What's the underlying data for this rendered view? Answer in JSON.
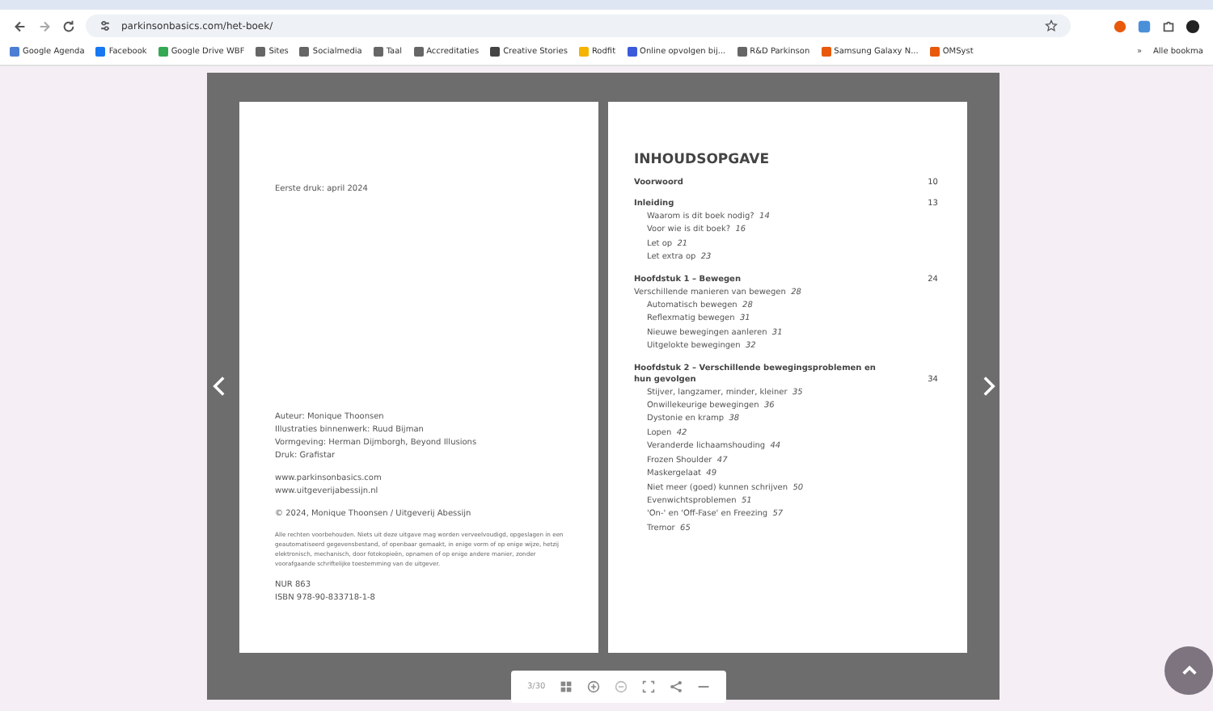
{
  "browser": {
    "url": "parkinsonbasics.com/het-boek/",
    "bookmarks": [
      {
        "label": "Google Agenda"
      },
      {
        "label": "Facebook"
      },
      {
        "label": "Google Drive WBF"
      },
      {
        "label": "Sites"
      },
      {
        "label": "Socialmedia"
      },
      {
        "label": "Taal"
      },
      {
        "label": "Accreditaties"
      },
      {
        "label": "Creative Stories"
      },
      {
        "label": "Rodfit"
      },
      {
        "label": "Online opvolgen bij..."
      },
      {
        "label": "R&D Parkinson"
      },
      {
        "label": "Samsung Galaxy N..."
      },
      {
        "label": "OMSyst"
      }
    ],
    "overflow": "»",
    "all_bookmarks": "Alle bookma"
  },
  "book": {
    "left_page": {
      "edition": "Eerste druk: april 2024",
      "credits": [
        "Auteur: Monique Thoonsen",
        "Illustraties binnenwerk: Ruud Bijman",
        "Vormgeving: Herman Dijmborgh, Beyond Illusions",
        "Druk: Grafistar"
      ],
      "websites": [
        "www.parkinsonbasics.com",
        "www.uitgeverijabessijn.nl"
      ],
      "copyright": "© 2024, Monique Thoonsen / Uitgeverij Abessijn",
      "rights": "Alle rechten voorbehouden. Niets uit deze uitgave mag worden verveelvoudigd, opgeslagen in een geautomatiseerd gegevensbestand, of openbaar gemaakt, in enige vorm of op enige wijze, hetzij elektronisch, mechanisch, door fotokopieën, opnamen of op enige andere manier, zonder voorafgaande schriftelijke toestemming van de uitgever.",
      "nur": "NUR 863",
      "isbn": "ISBN 978-90-833718-1-8"
    },
    "right_page": {
      "title": "INHOUDSOPGAVE",
      "sections": [
        {
          "title": "Voorwoord",
          "page": "10"
        },
        {
          "title": "Inleiding",
          "page": "13",
          "children": [
            {
              "label": "Waarom is dit boek nodig?",
              "page": "14"
            },
            {
              "label": "Voor wie is dit boek?",
              "page": "16"
            },
            {
              "label": "Let op",
              "page": "21"
            },
            {
              "label": "Let extra op",
              "page": "23"
            }
          ]
        },
        {
          "title": "Hoofdstuk 1 – Bewegen",
          "page": "24",
          "subtitle": {
            "label": "Verschillende manieren van bewegen",
            "page": "28"
          },
          "children": [
            {
              "label": "Automatisch bewegen",
              "page": "28"
            },
            {
              "label": "Reflexmatig bewegen",
              "page": "31"
            },
            {
              "label": "Nieuwe bewegingen aanleren",
              "page": "31"
            },
            {
              "label": "Uitgelokte bewegingen",
              "page": "32"
            }
          ]
        },
        {
          "title": "Hoofdstuk 2 – Verschillende bewegingsproblemen en hun gevolgen",
          "page": "34",
          "children": [
            {
              "label": "Stijver, langzamer, minder, kleiner",
              "page": "35"
            },
            {
              "label": "Onwillekeurige bewegingen",
              "page": "36"
            },
            {
              "label": "Dystonie en kramp",
              "page": "38"
            },
            {
              "label": "Lopen",
              "page": "42"
            },
            {
              "label": "Veranderde lichaamshouding",
              "page": "44"
            },
            {
              "label": "Frozen Shoulder",
              "page": "47"
            },
            {
              "label": "Maskergelaat",
              "page": "49"
            },
            {
              "label": "Niet meer (goed) kunnen schrijven",
              "page": "50"
            },
            {
              "label": "Evenwichtsproblemen",
              "page": "51"
            },
            {
              "label": "'On-' en 'Off-Fase' en Freezing",
              "page": "57"
            },
            {
              "label": "Tremor",
              "page": "65"
            }
          ]
        }
      ]
    }
  },
  "viewer": {
    "page_counter": "3/30"
  }
}
